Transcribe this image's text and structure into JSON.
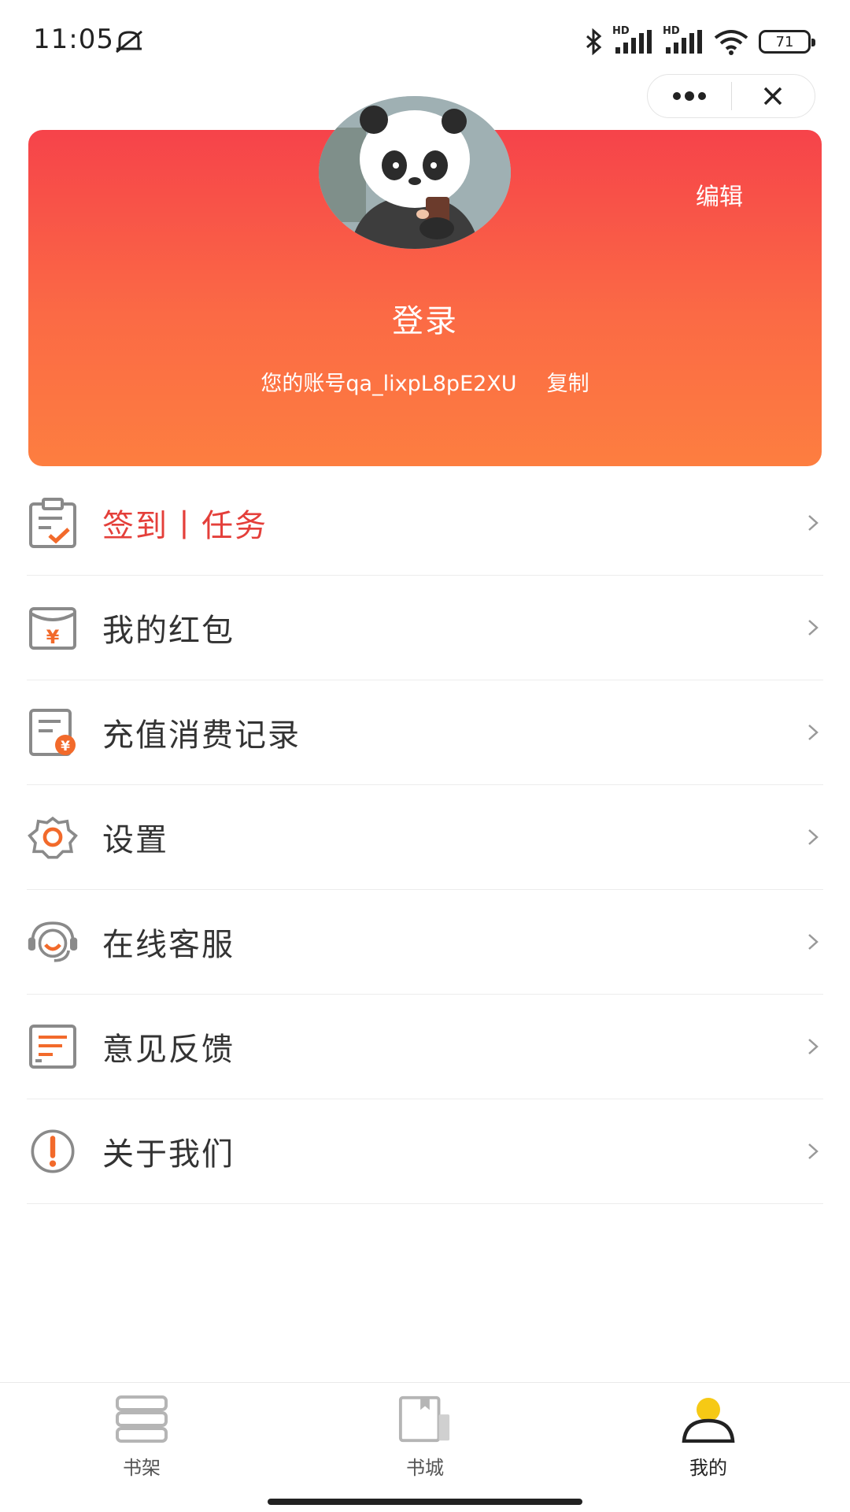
{
  "status": {
    "time": "11:05",
    "battery": "71",
    "network_1": "HD",
    "network_2": "HD"
  },
  "capsule": {
    "more_icon": "more-dots-icon",
    "close_icon": "close-icon"
  },
  "profile": {
    "edit_label": "编辑",
    "login_label": "登录",
    "account_text": "您的账号qa_lixpL8pE2XU",
    "copy_label": "复制",
    "gradient_top": "#f6434a",
    "gradient_bottom": "#fd7e40"
  },
  "menu": {
    "items": [
      {
        "label": "签到丨任务",
        "icon": "checklist-icon"
      },
      {
        "label": "我的红包",
        "icon": "red-envelope-icon"
      },
      {
        "label": "充值消费记录",
        "icon": "recharge-record-icon"
      },
      {
        "label": "设置",
        "icon": "gear-icon"
      },
      {
        "label": "在线客服",
        "icon": "headset-icon"
      },
      {
        "label": "意见反馈",
        "icon": "feedback-icon"
      },
      {
        "label": "关于我们",
        "icon": "info-icon"
      }
    ]
  },
  "tabs": [
    {
      "label": "书架",
      "icon": "bookshelf-icon",
      "active": false
    },
    {
      "label": "书城",
      "icon": "bookstore-icon",
      "active": false
    },
    {
      "label": "我的",
      "icon": "user-icon",
      "active": true
    }
  ],
  "colors": {
    "accent": "#e43f3a",
    "orange": "#f26a2b",
    "icon_gray": "#8a8a8a",
    "active_tab": "#f6c915"
  }
}
